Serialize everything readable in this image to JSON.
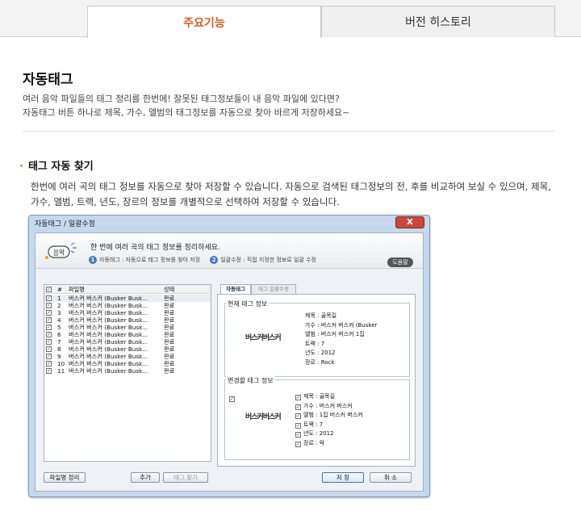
{
  "tabs": [
    {
      "label": "주요기능"
    },
    {
      "label": "버전 히스토리"
    }
  ],
  "section": {
    "title": "자동태그",
    "intro": [
      "여러 음악 파일들의 태그 정리를 한번에! 잘못된 태그정보들이 내 음악 파일에 있다면?",
      "자동태그 버튼 하나로 제목, 가수, 앨범의 태그정보를 자동으로 찾아 바르게 저장하세요~"
    ]
  },
  "feature": {
    "title": "태그 자동 찾기",
    "desc": [
      "한번에 여러 곡의 태그 정보를 자동으로 찾아 저장할 수 있습니다. 자동으로 검색된 태그정보의 전, 후를 비교하여 보실 수 있으며, 제목,",
      "가수, 앨범, 트랙, 년도, 장르의 정보를 개별적으로 선택하여 저장할 수 있습니다."
    ]
  },
  "window": {
    "title": "자동태그 / 일괄수정",
    "close": "X",
    "logo": "음악",
    "header_main": "한 번에 여러 곡의 태그 정보를 정리하세요.",
    "steps": [
      {
        "n": "1",
        "label": "자동태그 : 자동으로 태그 정보를 찾아 저장"
      },
      {
        "n": "2",
        "label": "일괄수정 : 직접 지정한 정보로 일괄 수정"
      }
    ],
    "help": "도움말",
    "list": {
      "headers": {
        "num": "#",
        "file": "파일명",
        "status": "상태"
      },
      "rows": [
        {
          "num": "1",
          "file": "버스커 버스커 (Busker Busk...",
          "status": "완료"
        },
        {
          "num": "2",
          "file": "버스커 버스커 (Busker Busk...",
          "status": "완료"
        },
        {
          "num": "3",
          "file": "버스커 버스커 (Busker Busk...",
          "status": "완료"
        },
        {
          "num": "4",
          "file": "버스커 버스커 (Busker Busk...",
          "status": "완료"
        },
        {
          "num": "5",
          "file": "버스커 버스커 (Busker Busk...",
          "status": "완료"
        },
        {
          "num": "6",
          "file": "버스커 버스커 (Busker Busk...",
          "status": "완료"
        },
        {
          "num": "7",
          "file": "버스커 버스커 (Busker Busk...",
          "status": "완료"
        },
        {
          "num": "8",
          "file": "버스커 버스커 (Busker Busk...",
          "status": "완료"
        },
        {
          "num": "9",
          "file": "버스커 버스커 (Busker Busk...",
          "status": "완료"
        },
        {
          "num": "10",
          "file": "버스커 버스커 (Busker Busk...",
          "status": "완료"
        },
        {
          "num": "11",
          "file": "버스커 버스커 (Busker Busk...",
          "status": "완료"
        }
      ]
    },
    "buttons": {
      "rename": "파일명 정리",
      "add": "추가",
      "find": "태그 찾기",
      "save": "저 장",
      "cancel": "취 소"
    },
    "right_tabs": {
      "auto": "자동태그",
      "batch": "태그 일괄수정"
    },
    "current": {
      "title": "현재 태그 정보",
      "album_art": "버스커버스커",
      "fields": [
        "제목 : 골목길",
        "가수 : 버스커 버스커 (Busker",
        "앨범 : 버스커 버스커 1집",
        "트랙 : 7",
        "년도 : 2012",
        "장르 : Rock"
      ]
    },
    "changed": {
      "title": "변경할 태그 정보",
      "album_art": "버스커버스커",
      "fields": [
        "제목 : 골목길",
        "가수 : 버스커 버스커",
        "앨범 : 1집 버스커 버스커",
        "트랙 : 7",
        "년도 : 2012",
        "장르 : 락"
      ]
    }
  }
}
